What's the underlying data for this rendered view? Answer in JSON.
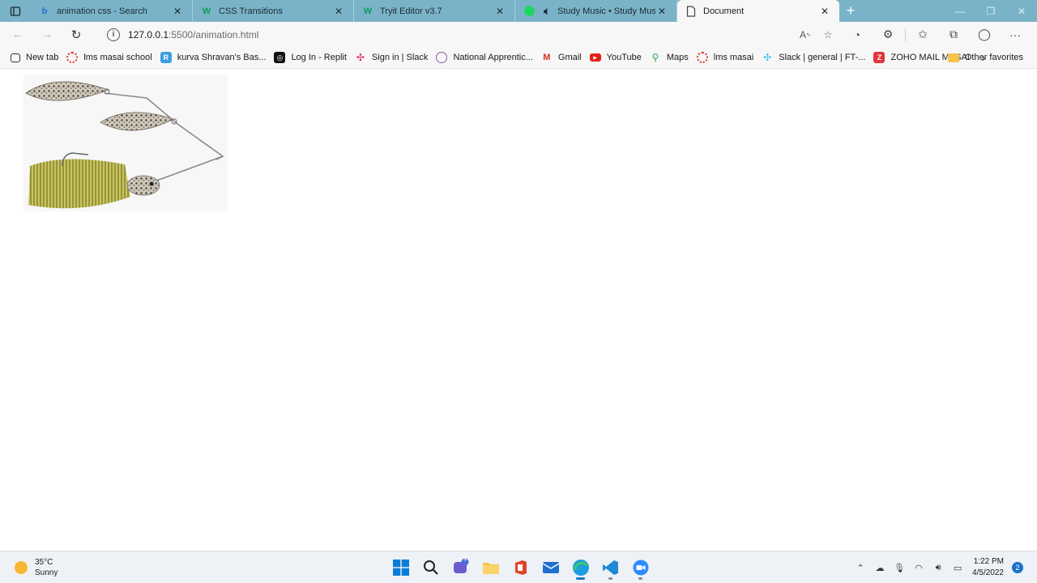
{
  "browser": {
    "tabs": [
      {
        "title": "animation css - Search",
        "icon": "bing-search-icon",
        "active": false
      },
      {
        "title": "CSS Transitions",
        "icon": "w3schools-icon",
        "active": false
      },
      {
        "title": "Tryit Editor v3.7",
        "icon": "w3schools-icon",
        "active": false
      },
      {
        "title": "Study Music • Study Music",
        "icon": "spotify-icon",
        "active": false,
        "audio": true
      },
      {
        "title": "Document",
        "icon": "document-icon",
        "active": true
      }
    ],
    "address": {
      "host": "127.0.0.1",
      "path": ":5500/animation.html"
    },
    "bookmarks": [
      {
        "label": "New tab",
        "icon": "new-tab-icon"
      },
      {
        "label": "lms masai school",
        "icon": "masai-icon"
      },
      {
        "label": "kurva Shravan's Bas...",
        "icon": "replit-doc-icon"
      },
      {
        "label": "Log In - Replit",
        "icon": "replit-icon"
      },
      {
        "label": "Sign in | Slack",
        "icon": "slack-icon"
      },
      {
        "label": "National Apprentic...",
        "icon": "apprentice-icon"
      },
      {
        "label": "Gmail",
        "icon": "gmail-icon"
      },
      {
        "label": "YouTube",
        "icon": "youtube-icon"
      },
      {
        "label": "Maps",
        "icon": "maps-icon"
      },
      {
        "label": "lms masai",
        "icon": "masai-icon"
      },
      {
        "label": "Slack | general | FT-...",
        "icon": "slack-icon"
      },
      {
        "label": "ZOHO MAIL MASAI",
        "icon": "zoho-icon"
      }
    ],
    "other_favorites": "Other favorites"
  },
  "page": {
    "image_alt": "spinnerbait fishing lure"
  },
  "taskbar": {
    "weather": {
      "temp": "35°C",
      "condition": "Sunny"
    },
    "clock": {
      "time": "1:22 PM",
      "date": "4/5/2022"
    },
    "notification_count": "2",
    "chat_badge": "1"
  },
  "colors": {
    "tabstrip": "#7ab3c8",
    "toolbar": "#f7f7f7",
    "taskbar": "#eef1f5",
    "accent": "#1a73c8"
  }
}
